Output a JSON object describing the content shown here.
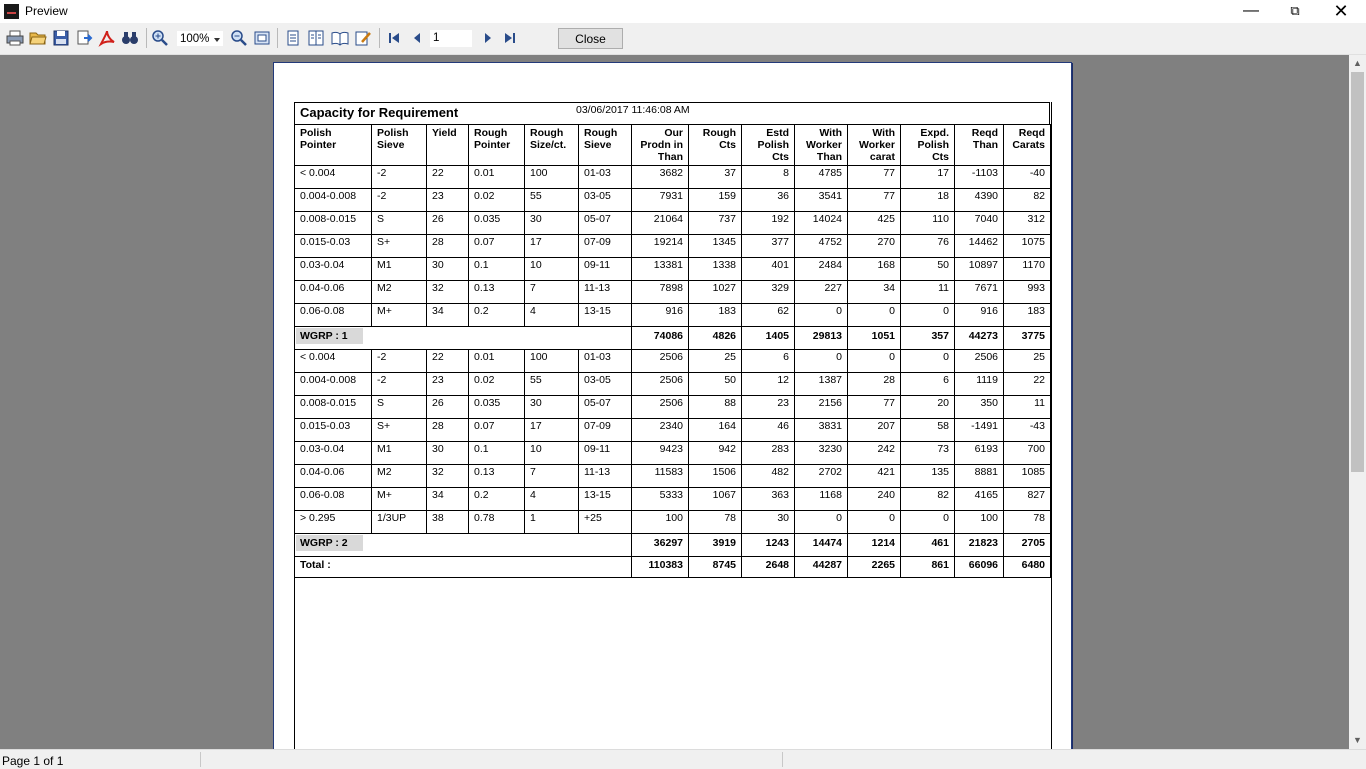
{
  "window": {
    "title": "Preview"
  },
  "toolbar": {
    "zoom": "100%",
    "page": "1",
    "close_label": "Close"
  },
  "status": {
    "page_info": "Page 1 of 1"
  },
  "report": {
    "title": "Capacity for Requirement",
    "datetime": "03/06/2017 11:46:08 AM",
    "headers": [
      [
        "Polish",
        "Pointer"
      ],
      [
        "Polish",
        "Sieve"
      ],
      [
        "Yield",
        ""
      ],
      [
        "Rough",
        "Pointer"
      ],
      [
        "Rough",
        "Size/ct."
      ],
      [
        "Rough",
        "Sieve"
      ],
      [
        "Our",
        "Prodn in",
        "Than"
      ],
      [
        "Rough",
        "Cts"
      ],
      [
        "Estd",
        "Polish",
        "Cts"
      ],
      [
        "With",
        "Worker",
        "Than"
      ],
      [
        "With",
        "Worker",
        "carat"
      ],
      [
        "Expd.",
        "Polish",
        "Cts"
      ],
      [
        "Reqd",
        "Than"
      ],
      [
        "Reqd",
        "Carats"
      ]
    ],
    "group1_rows": [
      [
        "< 0.004",
        "-2",
        "22",
        "0.01",
        "100",
        "01-03",
        "3682",
        "37",
        "8",
        "4785",
        "77",
        "17",
        "-1103",
        "-40"
      ],
      [
        "0.004-0.008",
        "-2",
        "23",
        "0.02",
        "55",
        "03-05",
        "7931",
        "159",
        "36",
        "3541",
        "77",
        "18",
        "4390",
        "82"
      ],
      [
        "0.008-0.015",
        "S",
        "26",
        "0.035",
        "30",
        "05-07",
        "21064",
        "737",
        "192",
        "14024",
        "425",
        "110",
        "7040",
        "312"
      ],
      [
        "0.015-0.03",
        "S+",
        "28",
        "0.07",
        "17",
        "07-09",
        "19214",
        "1345",
        "377",
        "4752",
        "270",
        "76",
        "14462",
        "1075"
      ],
      [
        "0.03-0.04",
        "M1",
        "30",
        "0.1",
        "10",
        "09-11",
        "13381",
        "1338",
        "401",
        "2484",
        "168",
        "50",
        "10897",
        "1170"
      ],
      [
        "0.04-0.06",
        "M2",
        "32",
        "0.13",
        "7",
        "11-13",
        "7898",
        "1027",
        "329",
        "227",
        "34",
        "11",
        "7671",
        "993"
      ],
      [
        "0.06-0.08",
        "M+",
        "34",
        "0.2",
        "4",
        "13-15",
        "916",
        "183",
        "62",
        "0",
        "0",
        "0",
        "916",
        "183"
      ]
    ],
    "group1_total": {
      "label": "WGRP : 1",
      "values": [
        "74086",
        "4826",
        "1405",
        "29813",
        "1051",
        "357",
        "44273",
        "3775"
      ]
    },
    "group2_rows": [
      [
        "< 0.004",
        "-2",
        "22",
        "0.01",
        "100",
        "01-03",
        "2506",
        "25",
        "6",
        "0",
        "0",
        "0",
        "2506",
        "25"
      ],
      [
        "0.004-0.008",
        "-2",
        "23",
        "0.02",
        "55",
        "03-05",
        "2506",
        "50",
        "12",
        "1387",
        "28",
        "6",
        "1119",
        "22"
      ],
      [
        "0.008-0.015",
        "S",
        "26",
        "0.035",
        "30",
        "05-07",
        "2506",
        "88",
        "23",
        "2156",
        "77",
        "20",
        "350",
        "11"
      ],
      [
        "0.015-0.03",
        "S+",
        "28",
        "0.07",
        "17",
        "07-09",
        "2340",
        "164",
        "46",
        "3831",
        "207",
        "58",
        "-1491",
        "-43"
      ],
      [
        "0.03-0.04",
        "M1",
        "30",
        "0.1",
        "10",
        "09-11",
        "9423",
        "942",
        "283",
        "3230",
        "242",
        "73",
        "6193",
        "700"
      ],
      [
        "0.04-0.06",
        "M2",
        "32",
        "0.13",
        "7",
        "11-13",
        "11583",
        "1506",
        "482",
        "2702",
        "421",
        "135",
        "8881",
        "1085"
      ],
      [
        "0.06-0.08",
        "M+",
        "34",
        "0.2",
        "4",
        "13-15",
        "5333",
        "1067",
        "363",
        "1168",
        "240",
        "82",
        "4165",
        "827"
      ],
      [
        "> 0.295",
        "1/3UP",
        "38",
        "0.78",
        "1",
        "+25",
        "100",
        "78",
        "30",
        "0",
        "0",
        "0",
        "100",
        "78"
      ]
    ],
    "group2_total": {
      "label": "WGRP : 2",
      "values": [
        "36297",
        "3919",
        "1243",
        "14474",
        "1214",
        "461",
        "21823",
        "2705"
      ]
    },
    "grand_total": {
      "label": "Total :",
      "values": [
        "110383",
        "8745",
        "2648",
        "44287",
        "2265",
        "861",
        "66096",
        "6480"
      ]
    }
  }
}
